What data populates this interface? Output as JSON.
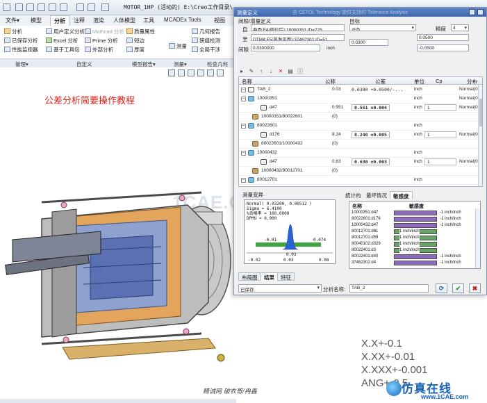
{
  "window": {
    "title": "MOTOR_1HP (活动的) E:\\Creo工作目录\\"
  },
  "menu_tabs": [
    "文件▾",
    "模型",
    "分析",
    "注释",
    "渲染",
    "人体模型",
    "工具",
    "MCADEx Tools",
    "视图"
  ],
  "ribbon": {
    "items": [
      {
        "label": "分析",
        "icon": "analysis-icon"
      },
      {
        "label": "已保存分析",
        "icon": "saved-analysis-icon"
      },
      {
        "label": "性能监视器",
        "icon": "performance-monitor-icon"
      },
      {
        "label": "用户定义分析",
        "icon": "user-analysis-icon"
      },
      {
        "label": "Excel 分析",
        "icon": "excel-icon"
      },
      {
        "label": "基于工具包",
        "icon": "toolkit-icon"
      },
      {
        "label": "Mathcad 分析",
        "icon": "mathcad-icon"
      },
      {
        "label": "Prime 分析",
        "icon": "prime-icon"
      },
      {
        "label": "外部分析",
        "icon": "external-analysis-icon"
      },
      {
        "label": "质量属性",
        "icon": "mass-properties-icon"
      },
      {
        "label": "短边",
        "icon": "short-edge-icon"
      },
      {
        "label": "厚度",
        "icon": "thickness-icon"
      },
      {
        "label": "测量",
        "icon": "measure-icon"
      },
      {
        "label": "几何报告",
        "icon": "geometry-report-icon"
      },
      {
        "label": "狭缝检测",
        "icon": "slot-check-icon"
      },
      {
        "label": "全局干涉",
        "icon": "global-interference-icon"
      }
    ],
    "groups": [
      "管理▾",
      "自定义",
      "模型报告▾",
      "测量▾",
      "检查几何"
    ]
  },
  "canvas": {
    "tutorial_title": "公差分析简要操作教程",
    "watermark": "1CAE.COM",
    "tolerance_notes": [
      "X.X+-0.1",
      "X.XX+-0.01",
      "X.XXX+-0.001",
      "ANG+-0.5"
    ],
    "credit": "精诚网 破衣哥/冉鑫",
    "brand": "仿真在线",
    "brand_url": "www.1CAE.com"
  },
  "dialog": {
    "title": "测量定义",
    "title_watermark": "由 CETOL Technology 提供支持的 Tolerance Analysis",
    "section_measure": "间隙/增量定义",
    "from_label": "自",
    "from_value": "曲面:F4(偏位后):10000351 ID=725",
    "to_label": "至",
    "to_value": "DTM4:F5(基准平面):37462302 ID=51",
    "gap_label": "间隙",
    "gap_value": "0.0300000",
    "gap_unit": "inch",
    "section_target": "目标",
    "target_type": "正负",
    "precision_label": "精度",
    "precision_value": "4",
    "target_nominal": "0.0300",
    "target_upper": "0.0500",
    "target_lower": "-0.0500",
    "toolbar_icons": [
      "new-measure-icon",
      "edit-icon",
      "move-up-icon",
      "move-down-icon",
      "delete-icon",
      "table-icon",
      "info-icon"
    ],
    "table": {
      "headers": [
        "名称",
        "公称",
        "公差",
        "单位",
        "Cp",
        "分布"
      ],
      "rows": [
        {
          "kind": "measure",
          "name": "TAB_2",
          "nominal": "0.03",
          "tolerance": "0.0300 +0.0500/-...",
          "unit": "inch",
          "cp": "",
          "dist": "Normal(0.0"
        },
        {
          "kind": "part",
          "name": "10000351",
          "nominal": "",
          "tolerance": "",
          "unit": "inch",
          "cp": "",
          "dist": "Normal(0.00"
        },
        {
          "kind": "dim",
          "name": "d47",
          "nominal": "0.551",
          "tolerance": "0.551 ±0.004",
          "unit": "inch",
          "cp": "1",
          "dist": "Normal(0.00"
        },
        {
          "kind": "asm",
          "name": "10000351/80022601",
          "nominal": "(0)",
          "tolerance": "",
          "unit": "",
          "cp": "",
          "dist": ""
        },
        {
          "kind": "part",
          "name": "80022601",
          "nominal": "",
          "tolerance": "",
          "unit": "inch",
          "cp": "",
          "dist": ""
        },
        {
          "kind": "dim",
          "name": "d176",
          "nominal": "8.24",
          "tolerance": "8.240 ±0.005",
          "unit": "inch",
          "cp": "1",
          "dist": "Normal(0.00"
        },
        {
          "kind": "asm",
          "name": "80022601/10000432",
          "nominal": "(0)",
          "tolerance": "",
          "unit": "",
          "cp": "",
          "dist": ""
        },
        {
          "kind": "part",
          "name": "10000432",
          "nominal": "",
          "tolerance": "",
          "unit": "inch",
          "cp": "",
          "dist": ""
        },
        {
          "kind": "dim",
          "name": "d47",
          "nominal": "0.63",
          "tolerance": "0.630 ±0.003",
          "unit": "inch",
          "cp": "1",
          "dist": "Normal(0.00"
        },
        {
          "kind": "asm",
          "name": "10000432/80012701",
          "nominal": "(0)",
          "tolerance": "",
          "unit": "",
          "cp": "",
          "dist": ""
        },
        {
          "kind": "part",
          "name": "80012701",
          "nominal": "",
          "tolerance": "",
          "unit": "inch",
          "cp": "",
          "dist": ""
        }
      ]
    },
    "variation_panel": {
      "title": "测量变异",
      "lines": [
        "Normal( 0.03200, 0.00512 )",
        "Sigma  = 6.4100",
        "%合格率 = 100.0000",
        "DPMU   = 0.000"
      ],
      "marker_left": "-0.01",
      "marker_right": "0.074",
      "marker_center": "0.03",
      "axis": [
        "-0.02",
        "0.03",
        "0.08"
      ]
    },
    "right_tabs": [
      "统计的",
      "最坏情况",
      "敏感度"
    ],
    "contribution": {
      "headers": [
        "名称",
        "敏感度"
      ],
      "rows": [
        {
          "name": "10000351:d47",
          "value": "-1 inch/inch",
          "color": "p"
        },
        {
          "name": "80022601:d176",
          "value": "-1 inch/inch",
          "color": "p"
        },
        {
          "name": "10000432:d47",
          "value": "-1 inch/inch",
          "color": "p"
        },
        {
          "name": "80012701:d61",
          "value": "1 inch/inch",
          "color": "g"
        },
        {
          "name": "80012701:d59",
          "value": "1 inch/inch",
          "color": "g"
        },
        {
          "name": "80040102:d329",
          "value": "1 inch/inch",
          "color": "g"
        },
        {
          "name": "80022401:d3",
          "value": "1 inch/inch",
          "color": "g"
        },
        {
          "name": "80022401:d40",
          "value": "-1 inch/inch",
          "color": "p"
        },
        {
          "name": "37462302:d4",
          "value": "-1 inch/inch",
          "color": "p"
        }
      ]
    },
    "bottom_tabs": [
      "布局图",
      "结果",
      "特征"
    ],
    "saved_value": "已保存",
    "analysis_name_label": "分析名称:",
    "analysis_name_value": "TAB_2",
    "colors": {
      "accent": "#3e67ab",
      "sens_positive": "#65a465",
      "sens_negative": "#8e6bbf"
    }
  }
}
